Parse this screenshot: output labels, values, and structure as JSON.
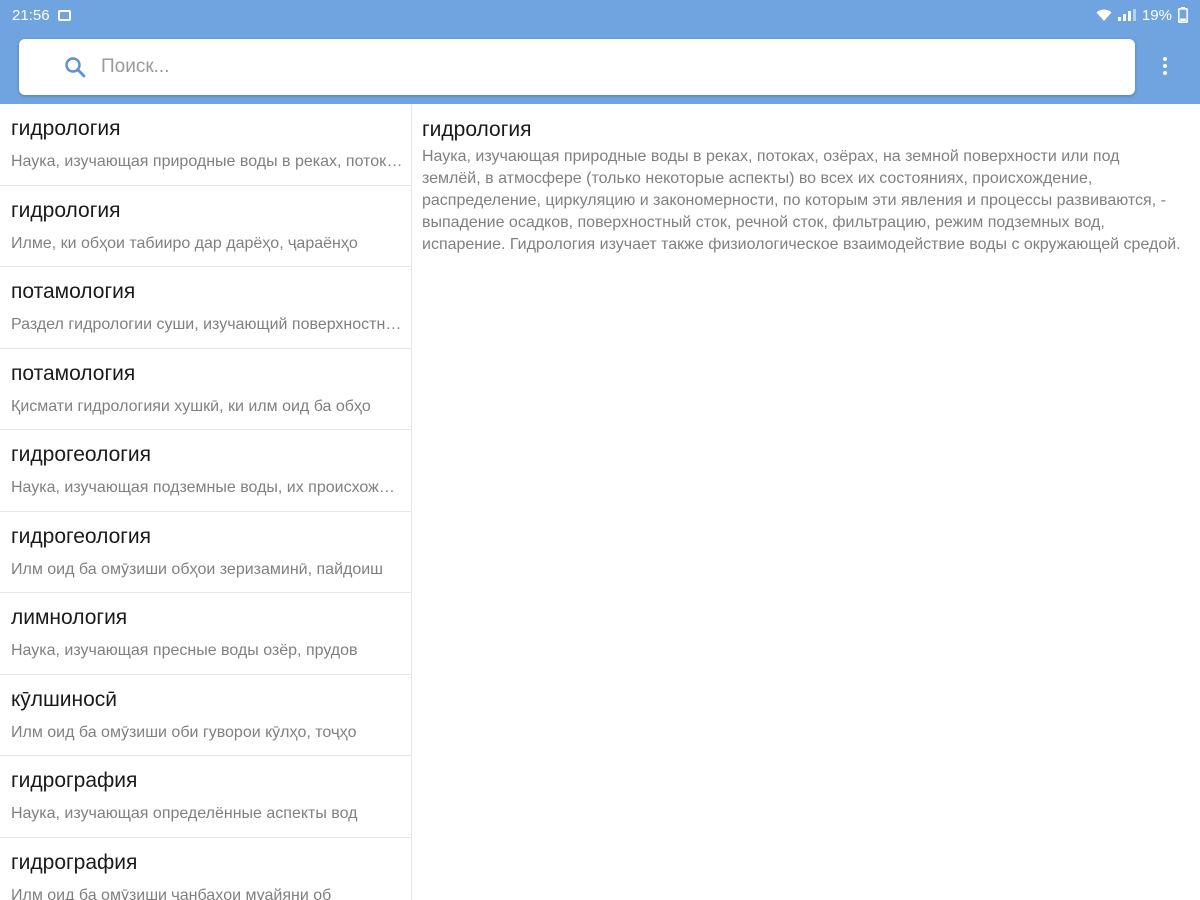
{
  "status_bar": {
    "time": "21:56",
    "battery": "19%"
  },
  "search": {
    "placeholder": "Поиск..."
  },
  "icons": {
    "search": "search-icon",
    "menu": "more-vert-icon",
    "image": "image-icon",
    "wifi": "wifi-icon",
    "signal": "signal-icon"
  },
  "colors": {
    "accent": "#6fa4e0",
    "search_icon": "#5b8fd6"
  },
  "list": {
    "items": [
      {
        "term": "гидрология",
        "snippet": "Наука, изучающая природные воды в реках, потоках, озёрах"
      },
      {
        "term": "гидрология",
        "snippet": "Илме, ки обҳои табииро дар дарёҳо, ҷараёнҳо"
      },
      {
        "term": "потамология",
        "snippet": "Раздел гидрологии суши, изучающий поверхностные воды"
      },
      {
        "term": "потамология",
        "snippet": "Қисмати гидрологияи хушкӣ, ки илм оид ба обҳо"
      },
      {
        "term": "гидрогеология",
        "snippet": "Наука, изучающая подземные воды, их происхождение"
      },
      {
        "term": "гидрогеология",
        "snippet": "Илм оид ба омӯзиши обҳои зеризаминӣ, пайдоиш"
      },
      {
        "term": "лимнология",
        "snippet": "Наука, изучающая пресные воды озёр, прудов"
      },
      {
        "term": "кӯлшиносӣ",
        "snippet": "Илм оид ба омӯзиши оби гуворои кӯлҳо, тоҷҳо"
      },
      {
        "term": "гидрография",
        "snippet": "Наука, изучающая определённые аспекты вод"
      },
      {
        "term": "гидрография",
        "snippet": "Илм оид ба омӯзиши ҷанбаҳои муайяни об"
      }
    ]
  },
  "detail": {
    "title": "гидрология",
    "body": "Наука, изучающая природные воды в реках, потоках, озёрах, на земной поверхности или под землёй, в атмосфере (только некоторые аспекты) во всех их состояниях, происхождение, распределение, циркуляцию и закономерности, по которым эти явления и процессы развиваются, - выпадение осадков, поверхностный сток, речной сток, фильтрацию, режим подземных вод, испарение. Гидрология изучает также физиологическое взаимодействие воды с окружающей средой."
  }
}
